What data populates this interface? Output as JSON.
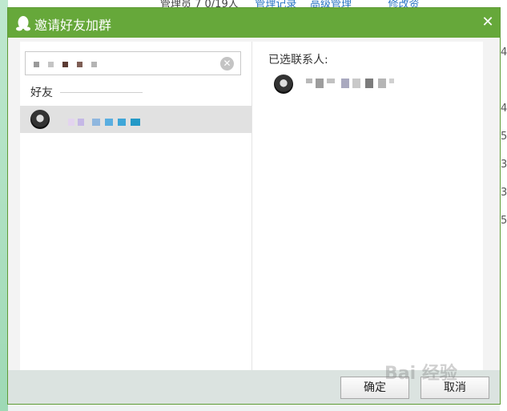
{
  "dialog": {
    "title": "邀请好友加群",
    "close_label": "✕"
  },
  "search": {
    "clear_label": "✕"
  },
  "friends": {
    "group_label": "好友"
  },
  "selected": {
    "label": "已选联系人:"
  },
  "buttons": {
    "ok_label": "确定",
    "cancel_label": "取消"
  },
  "background_app": {
    "top_text": "管理员 7 0/19人",
    "top_link_1": "管理记录",
    "top_link_2": "高级管理",
    "top_link_3": "修改资",
    "right_numbers": [
      "4",
      "4",
      "5",
      "3",
      "3",
      "5"
    ]
  },
  "watermark": "Bai 经验",
  "colors": {
    "titlebar": "#66a83a",
    "selected_row": "#e1e1e1",
    "footer": "#dbe3e0"
  }
}
